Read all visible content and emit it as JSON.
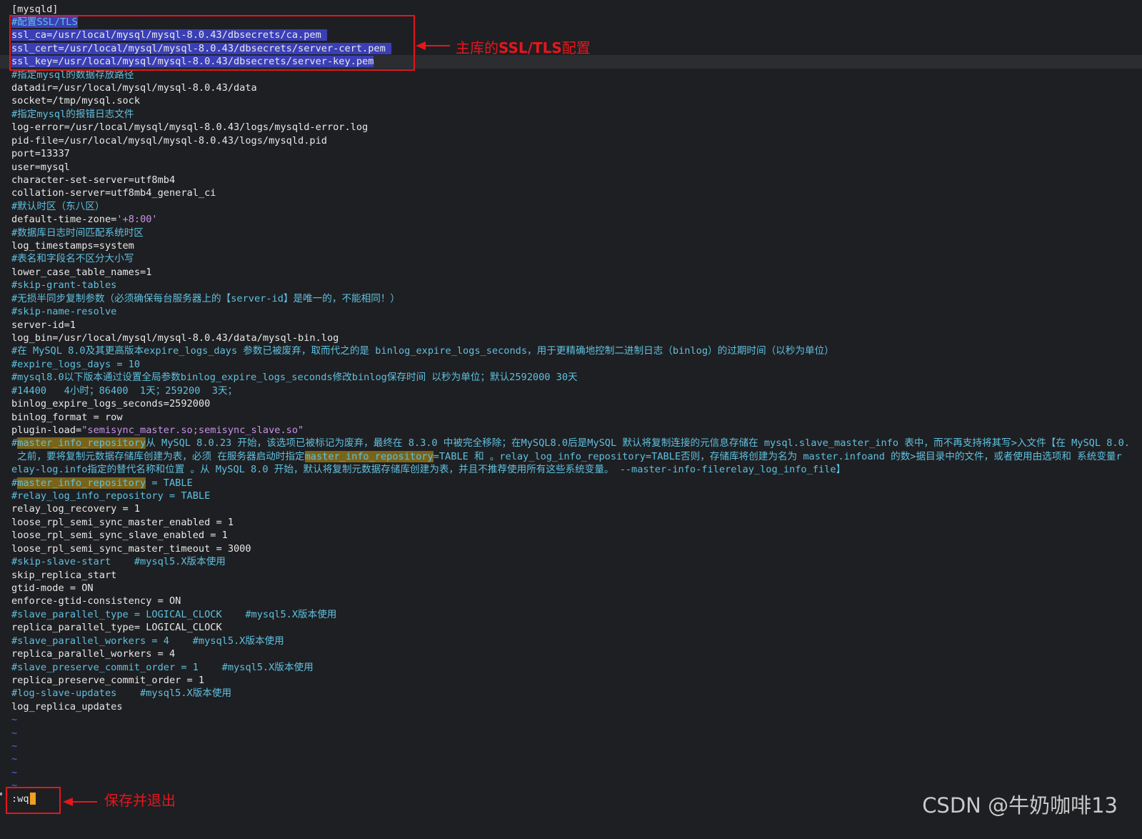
{
  "editor": {
    "lines": [
      {
        "segs": [
          {
            "t": "[mysqld]",
            "c": "normal"
          }
        ]
      },
      {
        "segs": [
          {
            "t": "#配置SSL/TLS",
            "c": "comment",
            "sel": true
          }
        ]
      },
      {
        "segs": [
          {
            "t": "ssl_ca=/usr/local/mysql/mysql-8.0.43/dbsecrets/ca.pem ",
            "c": "normal",
            "sel": true
          }
        ]
      },
      {
        "segs": [
          {
            "t": "ssl_cert=/usr/local/mysql/mysql-8.0.43/dbsecrets/server-cert.pem ",
            "c": "normal",
            "sel": true
          }
        ]
      },
      {
        "segs": [
          {
            "t": "ssl_key=/usr/local/mysql/mysql-8.0.43/dbsecrets/server-key.pem",
            "c": "normal",
            "sel": true
          }
        ],
        "cursor": true
      },
      {
        "segs": [
          {
            "t": "#指定mysql的数据存放路径",
            "c": "comment"
          }
        ]
      },
      {
        "segs": [
          {
            "t": "datadir=/usr/local/mysql/mysql-8.0.43/data",
            "c": "normal"
          }
        ]
      },
      {
        "segs": [
          {
            "t": "socket=/tmp/mysql.sock",
            "c": "normal"
          }
        ]
      },
      {
        "segs": [
          {
            "t": "#指定mysql的报错日志文件",
            "c": "comment"
          }
        ]
      },
      {
        "segs": [
          {
            "t": "log-error=/usr/local/mysql/mysql-8.0.43/logs/mysqld-error.log",
            "c": "normal"
          }
        ]
      },
      {
        "segs": [
          {
            "t": "pid-file=/usr/local/mysql/mysql-8.0.43/logs/mysqld.pid",
            "c": "normal"
          }
        ]
      },
      {
        "segs": [
          {
            "t": "port=13337",
            "c": "normal"
          }
        ]
      },
      {
        "segs": [
          {
            "t": "user=mysql",
            "c": "normal"
          }
        ]
      },
      {
        "segs": [
          {
            "t": "character-set-server=utf8mb4",
            "c": "normal"
          }
        ]
      },
      {
        "segs": [
          {
            "t": "collation-server=utf8mb4_general_ci",
            "c": "normal"
          }
        ]
      },
      {
        "segs": [
          {
            "t": "#默认时区（东八区）",
            "c": "comment"
          }
        ]
      },
      {
        "segs": [
          {
            "t": "default-time-zone=",
            "c": "normal"
          },
          {
            "t": "'+8:00'",
            "c": "string"
          }
        ]
      },
      {
        "segs": [
          {
            "t": "#数据库日志时间匹配系统时区",
            "c": "comment"
          }
        ]
      },
      {
        "segs": [
          {
            "t": "log_timestamps=system",
            "c": "normal"
          }
        ]
      },
      {
        "segs": [
          {
            "t": "#表名和字段名不区分大小写",
            "c": "comment"
          }
        ]
      },
      {
        "segs": [
          {
            "t": "lower_case_table_names=1",
            "c": "normal"
          }
        ]
      },
      {
        "segs": [
          {
            "t": "#skip-grant-tables",
            "c": "comment"
          }
        ]
      },
      {
        "segs": [
          {
            "t": "#无损半同步复制参数（必须确保每台服务器上的【server-id】是唯一的，不能相同！）",
            "c": "comment"
          }
        ]
      },
      {
        "segs": [
          {
            "t": "#skip-name-resolve",
            "c": "comment"
          }
        ]
      },
      {
        "segs": [
          {
            "t": "server-id=1",
            "c": "normal"
          }
        ]
      },
      {
        "segs": [
          {
            "t": "log_bin=/usr/local/mysql/mysql-8.0.43/data/mysql-bin.log",
            "c": "normal"
          }
        ]
      },
      {
        "segs": [
          {
            "t": "#在 MySQL 8.0及其更高版本expire_logs_days 参数已被废弃，取而代之的是 binlog_expire_logs_seconds，用于更精确地控制二进制日志（binlog）的过期时间（以秒为单位）",
            "c": "comment"
          }
        ]
      },
      {
        "segs": [
          {
            "t": "#expire_logs_days = 10",
            "c": "comment"
          }
        ]
      },
      {
        "segs": [
          {
            "t": "#mysql8.0以下版本通过设置全局参数binlog_expire_logs_seconds修改binlog保存时间 以秒为单位；默认2592000 30天",
            "c": "comment"
          }
        ]
      },
      {
        "segs": [
          {
            "t": "#14400   4小时；86400  1天；259200  3天；",
            "c": "comment"
          }
        ]
      },
      {
        "segs": [
          {
            "t": "binlog_expire_logs_seconds=2592000",
            "c": "normal"
          }
        ]
      },
      {
        "segs": [
          {
            "t": "binlog_format = row",
            "c": "normal"
          }
        ]
      },
      {
        "segs": [
          {
            "t": "plugin-load=",
            "c": "normal"
          },
          {
            "t": "\"semisync_master.so;semisync_slave.so\"",
            "c": "string"
          }
        ]
      },
      {
        "segs": [
          {
            "t": "#",
            "c": "comment"
          },
          {
            "t": "master_info_repository",
            "c": "comment",
            "hl": true
          },
          {
            "t": "从 MySQL 8.0.23 开始，该选项已被标记为废弃，最终在 8.3.0 中被完全移除；在MySQL8.0后是MySQL 默认将复制连接的元信息存储在 mysql.slave_master_info 表中，而不再支持将其写>入文件【在 MySQL 8.0.",
            "c": "comment"
          }
        ]
      },
      {
        "segs": [
          {
            "t": " 之前，要将复制元数据存储库创建为表，必须 在服务器启动时指定",
            "c": "comment"
          },
          {
            "t": "master_info_repository",
            "c": "comment",
            "hl": true
          },
          {
            "t": "=TABLE 和 。relay_log_info_repository=TABLE否则，存储库将创建为名为 master.infoand 的数>据目录中的文件，或者使用由选项和 系统变量r",
            "c": "comment"
          }
        ]
      },
      {
        "segs": [
          {
            "t": "elay-log.info指定的替代名称和位置 。从 MySQL 8.0 开始，默认将复制元数据存储库创建为表，并且不推荐使用所有这些系统变量。 --master-info-filerelay_log_info_file】",
            "c": "comment"
          }
        ]
      },
      {
        "segs": [
          {
            "t": "#",
            "c": "comment"
          },
          {
            "t": "master_info_repository",
            "c": "comment",
            "hl": true
          },
          {
            "t": " = TABLE",
            "c": "comment"
          }
        ]
      },
      {
        "segs": [
          {
            "t": "#relay_log_info_repository = TABLE",
            "c": "comment"
          }
        ]
      },
      {
        "segs": [
          {
            "t": "relay_log_recovery = 1",
            "c": "normal"
          }
        ]
      },
      {
        "segs": [
          {
            "t": "loose_rpl_semi_sync_master_enabled = 1",
            "c": "normal"
          }
        ]
      },
      {
        "segs": [
          {
            "t": "loose_rpl_semi_sync_slave_enabled = 1",
            "c": "normal"
          }
        ]
      },
      {
        "segs": [
          {
            "t": "loose_rpl_semi_sync_master_timeout = 3000",
            "c": "normal"
          }
        ]
      },
      {
        "segs": [
          {
            "t": "#skip-slave-start    #mysql5.X版本使用",
            "c": "comment"
          }
        ]
      },
      {
        "segs": [
          {
            "t": "skip_replica_start",
            "c": "normal"
          }
        ]
      },
      {
        "segs": [
          {
            "t": "gtid-mode = ON",
            "c": "normal"
          }
        ]
      },
      {
        "segs": [
          {
            "t": "enforce-gtid-consistency = ON",
            "c": "normal"
          }
        ]
      },
      {
        "segs": [
          {
            "t": "#slave_parallel_type = LOGICAL_CLOCK    #mysql5.X版本使用",
            "c": "comment"
          }
        ]
      },
      {
        "segs": [
          {
            "t": "replica_parallel_type= LOGICAL_CLOCK",
            "c": "normal"
          }
        ]
      },
      {
        "segs": [
          {
            "t": "#slave_parallel_workers = 4    #mysql5.X版本使用",
            "c": "comment"
          }
        ]
      },
      {
        "segs": [
          {
            "t": "replica_parallel_workers = 4",
            "c": "normal"
          }
        ]
      },
      {
        "segs": [
          {
            "t": "#slave_preserve_commit_order = 1    #mysql5.X版本使用",
            "c": "comment"
          }
        ]
      },
      {
        "segs": [
          {
            "t": "replica_preserve_commit_order = 1",
            "c": "normal"
          }
        ]
      },
      {
        "segs": [
          {
            "t": "#log-slave-updates    #mysql5.X版本使用",
            "c": "comment"
          }
        ]
      },
      {
        "segs": [
          {
            "t": "log_replica_updates",
            "c": "normal"
          }
        ]
      },
      {
        "segs": [
          {
            "t": "~",
            "c": "tilde"
          }
        ]
      },
      {
        "segs": [
          {
            "t": "~",
            "c": "tilde"
          }
        ]
      },
      {
        "segs": [
          {
            "t": "~",
            "c": "tilde"
          }
        ]
      },
      {
        "segs": [
          {
            "t": "~",
            "c": "tilde"
          }
        ]
      },
      {
        "segs": [
          {
            "t": "~",
            "c": "tilde"
          }
        ]
      },
      {
        "segs": [
          {
            "t": "~",
            "c": "tilde"
          }
        ]
      }
    ]
  },
  "command_line": {
    "text": ":wq"
  },
  "annotations": {
    "ssl_label_prefix": "主库的",
    "ssl_label_bold": "SSL/TLS",
    "ssl_label_suffix": "配置",
    "save_label": "保存并退出"
  },
  "watermark": "CSDN @牛奶咖啡13",
  "colors": {
    "background": "#1e1f22",
    "comment": "#5fc0e0",
    "selection": "#3b3fb6",
    "search_highlight": "#7a6419",
    "annotation_red": "#e5161d",
    "cursor": "#f0a020"
  }
}
